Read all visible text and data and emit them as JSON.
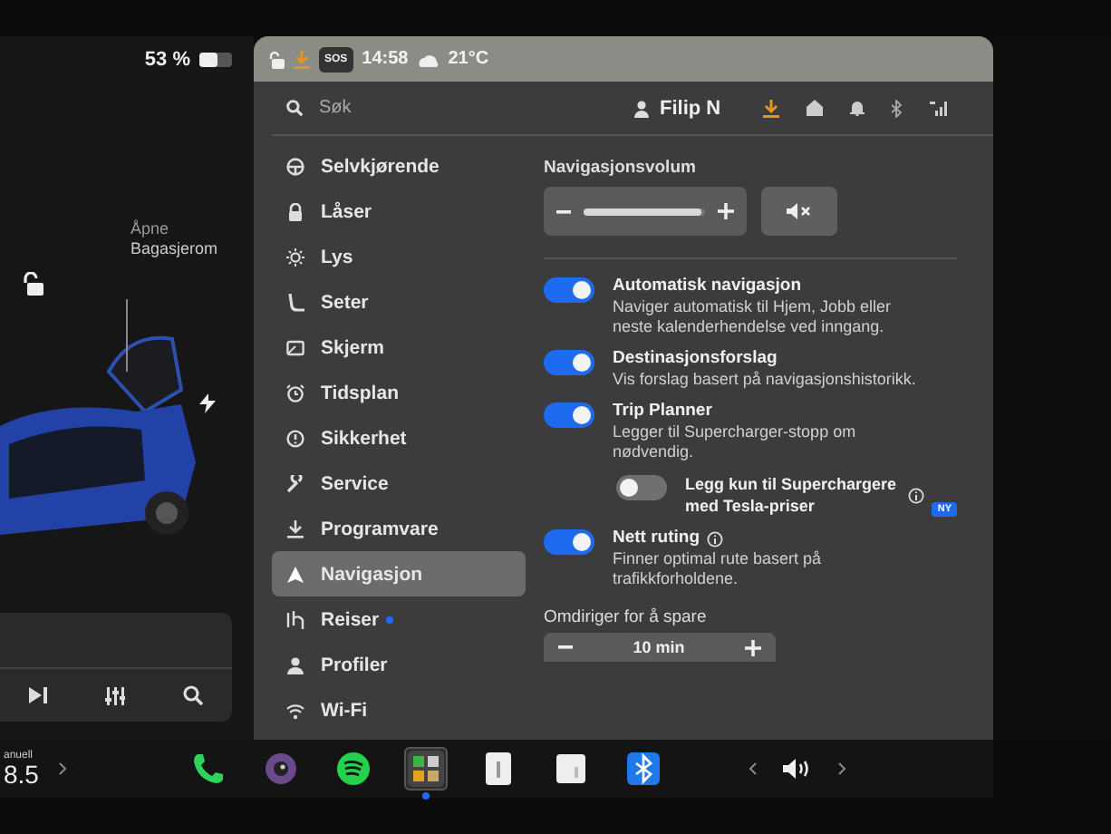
{
  "status": {
    "battery_percent": "53 %",
    "time": "14:58",
    "temperature": "21°C",
    "sos": "SOS"
  },
  "trunk": {
    "action": "Åpne",
    "label": "Bagasjerom"
  },
  "drive": {
    "mode": "anuell",
    "reading": "8.5"
  },
  "search": {
    "placeholder": "Søk"
  },
  "profile": {
    "name": "Filip N"
  },
  "sidebar": {
    "items": [
      {
        "label": "Selvkjørende",
        "selected": false,
        "notification": false
      },
      {
        "label": "Låser",
        "selected": false,
        "notification": false
      },
      {
        "label": "Lys",
        "selected": false,
        "notification": false
      },
      {
        "label": "Seter",
        "selected": false,
        "notification": false
      },
      {
        "label": "Skjerm",
        "selected": false,
        "notification": false
      },
      {
        "label": "Tidsplan",
        "selected": false,
        "notification": false
      },
      {
        "label": "Sikkerhet",
        "selected": false,
        "notification": false
      },
      {
        "label": "Service",
        "selected": false,
        "notification": false
      },
      {
        "label": "Programvare",
        "selected": false,
        "notification": false
      },
      {
        "label": "Navigasjon",
        "selected": true,
        "notification": false
      },
      {
        "label": "Reiser",
        "selected": false,
        "notification": true
      },
      {
        "label": "Profiler",
        "selected": false,
        "notification": false
      },
      {
        "label": "Wi-Fi",
        "selected": false,
        "notification": false
      }
    ]
  },
  "volume": {
    "label": "Navigasjonsvolum",
    "level": 0.97
  },
  "settings": [
    {
      "kind": "toggle",
      "title": "Automatisk navigasjon",
      "description": "Naviger automatisk til Hjem, Jobb eller neste kalenderhendelse ved inngang.",
      "on": true,
      "info": false
    },
    {
      "kind": "toggle",
      "title": "Destinasjonsforslag",
      "description": "Vis forslag basert på navigasjonshistorikk.",
      "on": true,
      "info": false
    },
    {
      "kind": "toggle",
      "title": "Trip Planner",
      "description": "Legger til Supercharger-stopp om nødvendig.",
      "on": true,
      "info": false
    },
    {
      "kind": "subtoggle",
      "title": "Legg kun til Superchargere med Tesla-priser",
      "on": false,
      "info": true,
      "badge": "NY"
    },
    {
      "kind": "toggle",
      "title": "Nett ruting",
      "description": "Finner optimal rute basert på trafikkforholdene.",
      "on": true,
      "info": true
    }
  ],
  "reroute": {
    "label": "Omdiriger for å spare",
    "value": "10 min"
  },
  "dock": {
    "apps": [
      {
        "selected": false
      },
      {
        "selected": false
      },
      {
        "selected": false
      },
      {
        "selected": true
      },
      {
        "selected": false
      },
      {
        "selected": false
      },
      {
        "selected": false
      }
    ]
  }
}
